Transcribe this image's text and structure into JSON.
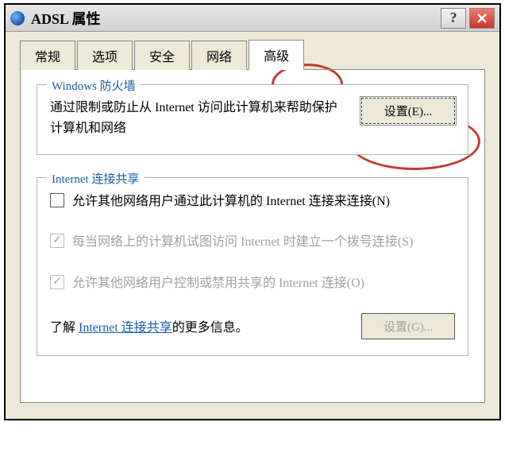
{
  "title": "ADSL 属性",
  "tabs": [
    "常规",
    "选项",
    "安全",
    "网络",
    "高级"
  ],
  "active_tab_index": 4,
  "firewall": {
    "legend": "Windows 防火墙",
    "description": "通过限制或防止从 Internet 访问此计算机来帮助保护计算机和网络",
    "settings_btn": "设置(E)..."
  },
  "ics": {
    "legend": "Internet 连接共享",
    "allow_others": "允许其他网络用户通过此计算机的 Internet 连接来连接(N)",
    "establish_dial": "每当网络上的计算机试图访问 Internet 时建立一个拨号连接(S)",
    "allow_control": "允许其他网络用户控制或禁用共享的 Internet 连接(O)",
    "learn_prefix": "了解",
    "learn_link": "Internet 连接共享",
    "learn_suffix": "的更多信息。",
    "settings_btn": "设置(G)..."
  },
  "checkbox_states": {
    "allow_others_checked": false,
    "establish_dial_checked": true,
    "allow_control_checked": true
  }
}
